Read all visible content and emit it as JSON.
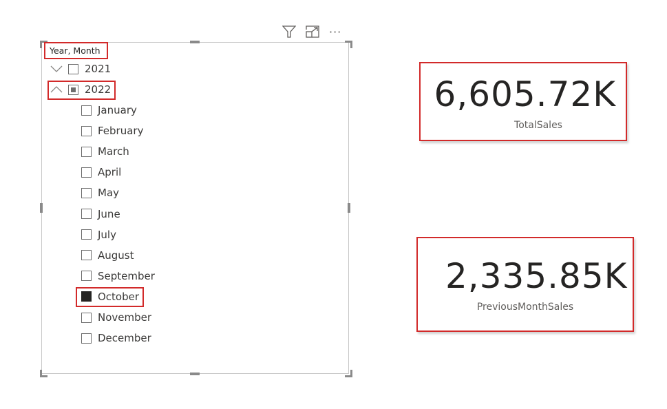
{
  "slicer": {
    "header": "Year, Month",
    "toolbar": {
      "filter_icon": "filter-icon",
      "focus_icon": "focus-mode-icon",
      "more_icon": "more-options-icon",
      "more_label": "···"
    },
    "years": [
      {
        "label": "2021",
        "expanded": false,
        "state": "unchecked"
      },
      {
        "label": "2022",
        "expanded": true,
        "state": "partial",
        "months": [
          {
            "label": "January",
            "checked": false
          },
          {
            "label": "February",
            "checked": false
          },
          {
            "label": "March",
            "checked": false
          },
          {
            "label": "April",
            "checked": false
          },
          {
            "label": "May",
            "checked": false
          },
          {
            "label": "June",
            "checked": false
          },
          {
            "label": "July",
            "checked": false
          },
          {
            "label": "August",
            "checked": false
          },
          {
            "label": "September",
            "checked": false
          },
          {
            "label": "October",
            "checked": true
          },
          {
            "label": "November",
            "checked": false
          },
          {
            "label": "December",
            "checked": false
          }
        ]
      }
    ]
  },
  "cards": [
    {
      "value": "6,605.72K",
      "label": "TotalSales"
    },
    {
      "value": "2,335.85K",
      "label": "PreviousMonthSales"
    }
  ],
  "colors": {
    "highlight": "#d22a2a",
    "text": "#252423",
    "label": "#605e5c"
  }
}
